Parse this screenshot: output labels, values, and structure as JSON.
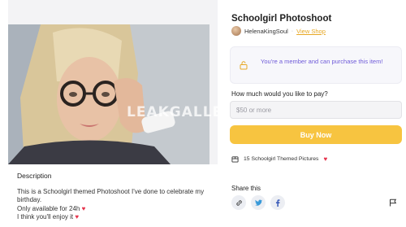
{
  "product": {
    "title": "Schoolgirl Photoshoot",
    "creator": "HelenaKingSoul",
    "separator": "·",
    "view_shop": "View Shop"
  },
  "image": {
    "watermark": "LEAKGALLE"
  },
  "description": {
    "heading": "Description",
    "lines": [
      "This is a Schoolgirl themed Photoshoot I've done to celebrate my birthday.",
      "Only available for 24h",
      "I think you'll enjoy it"
    ]
  },
  "notice": {
    "text": "You're a member and can purchase this item!"
  },
  "payment": {
    "label": "How much would you like to pay?",
    "placeholder": "$50 or more",
    "buy_label": "Buy Now"
  },
  "included": {
    "text": "15 Schoolgirl Themed Pictures"
  },
  "share": {
    "label": "Share this"
  },
  "icons": {
    "heart": "heart-icon",
    "lock": "lock-icon",
    "package": "package-icon",
    "link": "link-icon",
    "twitter": "twitter-icon",
    "facebook": "facebook-icon",
    "flag": "flag-icon"
  },
  "colors": {
    "accent": "#f7c440",
    "link": "#e7a825",
    "notice_text": "#6f5bd9",
    "heart": "#e5324b"
  }
}
